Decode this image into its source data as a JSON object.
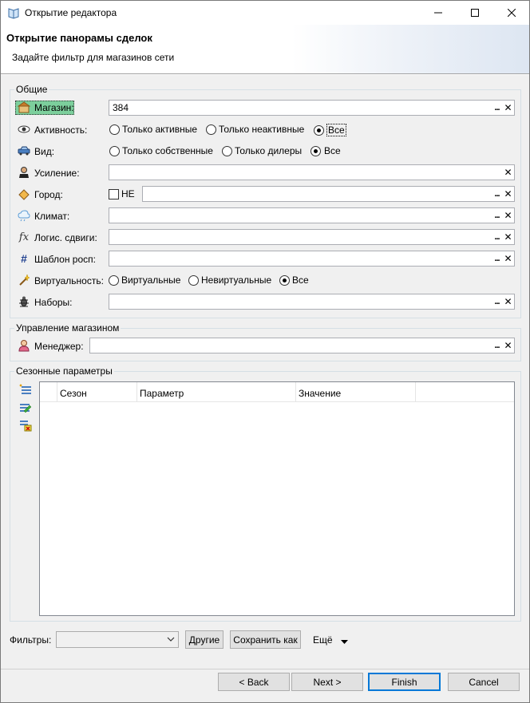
{
  "window": {
    "title": "Открытие редактора",
    "icon": "book-icon",
    "controls": {
      "minimize": "—",
      "maximize": "☐",
      "close": "✕"
    }
  },
  "header": {
    "title": "Открытие панорамы сделок",
    "subtitle": "Задайте фильтр для магазинов сети"
  },
  "general": {
    "group_label": "Общие",
    "shop": {
      "label": "Магазин:",
      "value": "384"
    },
    "activity": {
      "label": "Активность:",
      "options": [
        "Только активные",
        "Только неактивные",
        "Все"
      ],
      "selected": "Все"
    },
    "kind": {
      "label": "Вид:",
      "options": [
        "Только собственные",
        "Только дилеры",
        "Все"
      ],
      "selected": "Все"
    },
    "boost": {
      "label": "Усиление:",
      "value": ""
    },
    "city": {
      "label": "Город:",
      "not_label": "НЕ",
      "value": ""
    },
    "climate": {
      "label": "Климат:",
      "value": ""
    },
    "logistic": {
      "label": "Логис. сдвиги:",
      "value": ""
    },
    "template": {
      "label": "Шаблон росп:",
      "value": ""
    },
    "virtuality": {
      "label": "Виртуальность:",
      "options": [
        "Виртуальные",
        "Невиртуальные",
        "Все"
      ],
      "selected": "Все"
    },
    "sets": {
      "label": "Наборы:",
      "value": ""
    }
  },
  "management": {
    "group_label": "Управление магазином",
    "manager": {
      "label": "Менеджер:",
      "value": ""
    }
  },
  "seasonal": {
    "group_label": "Сезонные параметры",
    "columns": [
      "Сезон",
      "Параметр",
      "Значение"
    ],
    "rows": []
  },
  "filters": {
    "label": "Фильтры:",
    "combo_value": "",
    "other_button": "Другие",
    "save_as_button": "Сохранить как",
    "more_label": "Ещё"
  },
  "footer": {
    "back": "< Back",
    "next": "Next >",
    "finish": "Finish",
    "cancel": "Cancel"
  },
  "colors": {
    "selected_label_bg": "#7ccf9c",
    "primary_border": "#0078d7",
    "panel_bg": "#f0f0f0"
  }
}
